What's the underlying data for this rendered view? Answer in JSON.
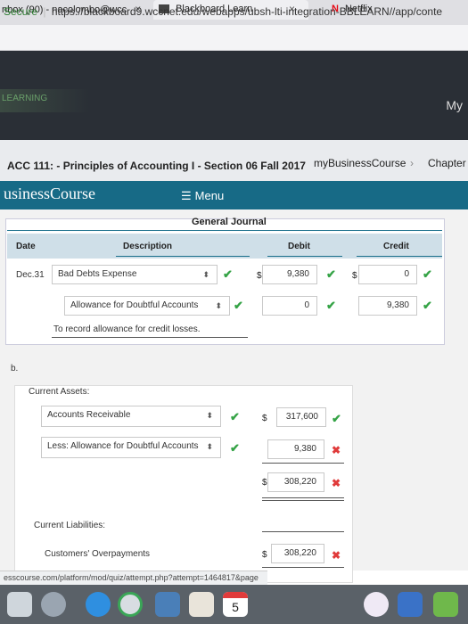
{
  "tabs": [
    {
      "label": "nbox (90) - nacolombo@wcc",
      "close": "×"
    },
    {
      "label": "Blackboard Learn",
      "close": "×"
    },
    {
      "label": "Netflix"
    }
  ],
  "url": {
    "secure": "Secure",
    "address": "https://blackboard9.wccnet.edu/webapps/ubsh-lti-integration-BBLEARN//app/conte"
  },
  "site": {
    "logo": "LEARNING",
    "my": "My"
  },
  "course": {
    "title": "ACC 111: - Principles of Accounting I - Section 06 Fall 2017",
    "breadcrumb": "myBusinessCourse",
    "breadcrumb_next": "Chapter",
    "brand": "usinessCourse",
    "menu": "Menu"
  },
  "journal": {
    "title": "General Journal",
    "headers": {
      "date": "Date",
      "description": "Description",
      "debit": "Debit",
      "credit": "Credit"
    },
    "date": "Dec.31",
    "row1": {
      "account": "Bad Debts Expense",
      "debit": "9,380",
      "credit": "0"
    },
    "row2": {
      "account": "Allowance for Doubtful Accounts",
      "debit": "0",
      "credit": "9,380"
    },
    "dollar": "$",
    "memo": "To record allowance for credit losses."
  },
  "part_b": {
    "label": "b.",
    "current_assets": "Current Assets:",
    "ar": {
      "account": "Accounts Receivable",
      "amount": "317,600"
    },
    "allow": {
      "account": "Less: Allowance for Doubtful Accounts",
      "amount": "9,380"
    },
    "net": {
      "amount": "308,220"
    },
    "current_liabilities": "Current Liabilities:",
    "cust": {
      "account": "Customers' Overpayments",
      "amount": "308,220"
    },
    "dollar": "$"
  },
  "status_url": "esscourse.com/platform/mod/quiz/attempt.php?attempt=1464817&page",
  "dock": {
    "calendar_day": "5"
  },
  "colors": {
    "teal": "#176a86",
    "check": "#35a346",
    "cross": "#e03b3b"
  }
}
